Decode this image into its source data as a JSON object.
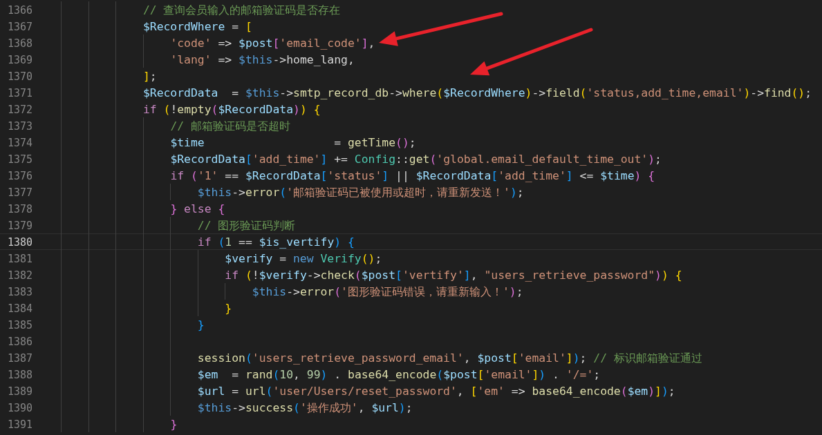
{
  "editor": {
    "lines": [
      {
        "number": "1366",
        "current": false,
        "tokens": [
          {
            "kind": "comment",
            "text": "                // 查询会员输入的邮箱验证码是否存在"
          }
        ]
      },
      {
        "number": "1367",
        "current": false,
        "tokens": [
          {
            "kind": "variable",
            "text": "                $RecordWhere"
          },
          {
            "kind": "plain",
            "text": " = "
          },
          {
            "kind": "bracket",
            "text": "[",
            "color": "#ffd700"
          }
        ]
      },
      {
        "number": "1368",
        "current": false,
        "tokens": [
          {
            "kind": "string",
            "text": "                    'code'"
          },
          {
            "kind": "plain",
            "text": " => "
          },
          {
            "kind": "variable",
            "text": "$post"
          },
          {
            "kind": "bracket",
            "text": "[",
            "color": "#da70d6"
          },
          {
            "kind": "string",
            "text": "'email_code'"
          },
          {
            "kind": "bracket",
            "text": "]",
            "color": "#da70d6"
          },
          {
            "kind": "plain",
            "text": ","
          }
        ]
      },
      {
        "number": "1369",
        "current": false,
        "tokens": [
          {
            "kind": "string",
            "text": "                    'lang'"
          },
          {
            "kind": "plain",
            "text": " => "
          },
          {
            "kind": "storage",
            "text": "$this"
          },
          {
            "kind": "plain",
            "text": "->home_lang,"
          }
        ]
      },
      {
        "number": "1370",
        "current": false,
        "tokens": [
          {
            "kind": "bracket",
            "text": "                ]",
            "color": "#ffd700"
          },
          {
            "kind": "plain",
            "text": ";"
          }
        ]
      },
      {
        "number": "1371",
        "current": false,
        "tokens": [
          {
            "kind": "variable",
            "text": "                $RecordData"
          },
          {
            "kind": "plain",
            "text": "  = "
          },
          {
            "kind": "storage",
            "text": "$this"
          },
          {
            "kind": "plain",
            "text": "->"
          },
          {
            "kind": "function",
            "text": "smtp_record_db"
          },
          {
            "kind": "plain",
            "text": "->"
          },
          {
            "kind": "function",
            "text": "where"
          },
          {
            "kind": "bracket",
            "text": "(",
            "color": "#ffd700"
          },
          {
            "kind": "variable",
            "text": "$RecordWhere"
          },
          {
            "kind": "bracket",
            "text": ")",
            "color": "#ffd700"
          },
          {
            "kind": "plain",
            "text": "->"
          },
          {
            "kind": "function",
            "text": "field"
          },
          {
            "kind": "bracket",
            "text": "(",
            "color": "#ffd700"
          },
          {
            "kind": "string",
            "text": "'status,add_time,email'"
          },
          {
            "kind": "bracket",
            "text": ")",
            "color": "#ffd700"
          },
          {
            "kind": "plain",
            "text": "->"
          },
          {
            "kind": "function",
            "text": "find"
          },
          {
            "kind": "bracket",
            "text": "()",
            "color": "#ffd700"
          },
          {
            "kind": "plain",
            "text": ";"
          }
        ]
      },
      {
        "number": "1372",
        "current": false,
        "tokens": [
          {
            "kind": "keyword",
            "text": "                if"
          },
          {
            "kind": "bracket",
            "text": " (",
            "color": "#ffd700"
          },
          {
            "kind": "plain",
            "text": "!"
          },
          {
            "kind": "function",
            "text": "empty"
          },
          {
            "kind": "bracket",
            "text": "(",
            "color": "#da70d6"
          },
          {
            "kind": "variable",
            "text": "$RecordData"
          },
          {
            "kind": "bracket",
            "text": ")",
            "color": "#da70d6"
          },
          {
            "kind": "bracket",
            "text": ")",
            "color": "#ffd700"
          },
          {
            "kind": "bracket",
            "text": " {",
            "color": "#ffd700"
          }
        ]
      },
      {
        "number": "1373",
        "current": false,
        "tokens": [
          {
            "kind": "comment",
            "text": "                    // 邮箱验证码是否超时"
          }
        ]
      },
      {
        "number": "1374",
        "current": false,
        "tokens": [
          {
            "kind": "variable",
            "text": "                    $time"
          },
          {
            "kind": "plain",
            "text": "                   = "
          },
          {
            "kind": "function",
            "text": "getTime"
          },
          {
            "kind": "bracket",
            "text": "()",
            "color": "#da70d6"
          },
          {
            "kind": "plain",
            "text": ";"
          }
        ]
      },
      {
        "number": "1375",
        "current": false,
        "tokens": [
          {
            "kind": "variable",
            "text": "                    $RecordData"
          },
          {
            "kind": "bracket",
            "text": "[",
            "color": "#179fff"
          },
          {
            "kind": "string",
            "text": "'add_time'"
          },
          {
            "kind": "bracket",
            "text": "]",
            "color": "#179fff"
          },
          {
            "kind": "plain",
            "text": " += "
          },
          {
            "kind": "type",
            "text": "Config"
          },
          {
            "kind": "plain",
            "text": "::"
          },
          {
            "kind": "function",
            "text": "get"
          },
          {
            "kind": "bracket",
            "text": "(",
            "color": "#da70d6"
          },
          {
            "kind": "string",
            "text": "'global.email_default_time_out'"
          },
          {
            "kind": "bracket",
            "text": ")",
            "color": "#da70d6"
          },
          {
            "kind": "plain",
            "text": ";"
          }
        ]
      },
      {
        "number": "1376",
        "current": false,
        "tokens": [
          {
            "kind": "keyword",
            "text": "                    if"
          },
          {
            "kind": "bracket",
            "text": " (",
            "color": "#da70d6"
          },
          {
            "kind": "string",
            "text": "'1'"
          },
          {
            "kind": "plain",
            "text": " == "
          },
          {
            "kind": "variable",
            "text": "$RecordData"
          },
          {
            "kind": "bracket",
            "text": "[",
            "color": "#179fff"
          },
          {
            "kind": "string",
            "text": "'status'"
          },
          {
            "kind": "bracket",
            "text": "]",
            "color": "#179fff"
          },
          {
            "kind": "plain",
            "text": " || "
          },
          {
            "kind": "variable",
            "text": "$RecordData"
          },
          {
            "kind": "bracket",
            "text": "[",
            "color": "#179fff"
          },
          {
            "kind": "string",
            "text": "'add_time'"
          },
          {
            "kind": "bracket",
            "text": "]",
            "color": "#179fff"
          },
          {
            "kind": "plain",
            "text": " <= "
          },
          {
            "kind": "variable",
            "text": "$time"
          },
          {
            "kind": "bracket",
            "text": ")",
            "color": "#da70d6"
          },
          {
            "kind": "bracket",
            "text": " {",
            "color": "#da70d6"
          }
        ]
      },
      {
        "number": "1377",
        "current": false,
        "tokens": [
          {
            "kind": "storage",
            "text": "                        $this"
          },
          {
            "kind": "plain",
            "text": "->"
          },
          {
            "kind": "function",
            "text": "error"
          },
          {
            "kind": "bracket",
            "text": "(",
            "color": "#179fff"
          },
          {
            "kind": "string",
            "text": "'邮箱验证码已被使用或超时，请重新发送！'"
          },
          {
            "kind": "bracket",
            "text": ")",
            "color": "#179fff"
          },
          {
            "kind": "plain",
            "text": ";"
          }
        ]
      },
      {
        "number": "1378",
        "current": false,
        "tokens": [
          {
            "kind": "bracket",
            "text": "                    }",
            "color": "#da70d6"
          },
          {
            "kind": "keyword",
            "text": " else"
          },
          {
            "kind": "bracket",
            "text": " {",
            "color": "#da70d6"
          }
        ]
      },
      {
        "number": "1379",
        "current": false,
        "tokens": [
          {
            "kind": "comment",
            "text": "                        // 图形验证码判断"
          }
        ]
      },
      {
        "number": "1380",
        "current": true,
        "tokens": [
          {
            "kind": "keyword",
            "text": "                        if"
          },
          {
            "kind": "bracket",
            "text": " (",
            "color": "#179fff"
          },
          {
            "kind": "number",
            "text": "1"
          },
          {
            "kind": "plain",
            "text": " == "
          },
          {
            "kind": "variable",
            "text": "$is_vertify"
          },
          {
            "kind": "bracket",
            "text": ")",
            "color": "#179fff"
          },
          {
            "kind": "bracket",
            "text": " {",
            "color": "#179fff"
          }
        ]
      },
      {
        "number": "1381",
        "current": false,
        "tokens": [
          {
            "kind": "variable",
            "text": "                            $verify"
          },
          {
            "kind": "plain",
            "text": " = "
          },
          {
            "kind": "storage",
            "text": "new"
          },
          {
            "kind": "type",
            "text": " Verify"
          },
          {
            "kind": "bracket",
            "text": "()",
            "color": "#ffd700"
          },
          {
            "kind": "plain",
            "text": ";"
          }
        ]
      },
      {
        "number": "1382",
        "current": false,
        "tokens": [
          {
            "kind": "keyword",
            "text": "                            if"
          },
          {
            "kind": "bracket",
            "text": " (",
            "color": "#ffd700"
          },
          {
            "kind": "plain",
            "text": "!"
          },
          {
            "kind": "variable",
            "text": "$verify"
          },
          {
            "kind": "plain",
            "text": "->"
          },
          {
            "kind": "function",
            "text": "check"
          },
          {
            "kind": "bracket",
            "text": "(",
            "color": "#da70d6"
          },
          {
            "kind": "variable",
            "text": "$post"
          },
          {
            "kind": "bracket",
            "text": "[",
            "color": "#179fff"
          },
          {
            "kind": "string",
            "text": "'vertify'"
          },
          {
            "kind": "bracket",
            "text": "]",
            "color": "#179fff"
          },
          {
            "kind": "plain",
            "text": ", "
          },
          {
            "kind": "string",
            "text": "\"users_retrieve_password\""
          },
          {
            "kind": "bracket",
            "text": ")",
            "color": "#da70d6"
          },
          {
            "kind": "bracket",
            "text": ")",
            "color": "#ffd700"
          },
          {
            "kind": "bracket",
            "text": " {",
            "color": "#ffd700"
          }
        ]
      },
      {
        "number": "1383",
        "current": false,
        "tokens": [
          {
            "kind": "storage",
            "text": "                                $this"
          },
          {
            "kind": "plain",
            "text": "->"
          },
          {
            "kind": "function",
            "text": "error"
          },
          {
            "kind": "bracket",
            "text": "(",
            "color": "#da70d6"
          },
          {
            "kind": "string",
            "text": "'图形验证码错误，请重新输入！'"
          },
          {
            "kind": "bracket",
            "text": ")",
            "color": "#da70d6"
          },
          {
            "kind": "plain",
            "text": ";"
          }
        ]
      },
      {
        "number": "1384",
        "current": false,
        "tokens": [
          {
            "kind": "bracket",
            "text": "                            }",
            "color": "#ffd700"
          }
        ]
      },
      {
        "number": "1385",
        "current": false,
        "tokens": [
          {
            "kind": "bracket",
            "text": "                        }",
            "color": "#179fff"
          }
        ]
      },
      {
        "number": "1386",
        "current": false
      },
      {
        "number": "1387",
        "current": false,
        "tokens": [
          {
            "kind": "function",
            "text": "                        session"
          },
          {
            "kind": "bracket",
            "text": "(",
            "color": "#179fff"
          },
          {
            "kind": "string",
            "text": "'users_retrieve_password_email'"
          },
          {
            "kind": "plain",
            "text": ", "
          },
          {
            "kind": "variable",
            "text": "$post"
          },
          {
            "kind": "bracket",
            "text": "[",
            "color": "#ffd700"
          },
          {
            "kind": "string",
            "text": "'email'"
          },
          {
            "kind": "bracket",
            "text": "]",
            "color": "#ffd700"
          },
          {
            "kind": "bracket",
            "text": ")",
            "color": "#179fff"
          },
          {
            "kind": "plain",
            "text": ";"
          },
          {
            "kind": "comment",
            "text": " // 标识邮箱验证通过"
          }
        ]
      },
      {
        "number": "1388",
        "current": false,
        "tokens": [
          {
            "kind": "variable",
            "text": "                        $em"
          },
          {
            "kind": "plain",
            "text": "  = "
          },
          {
            "kind": "function",
            "text": "rand"
          },
          {
            "kind": "bracket",
            "text": "(",
            "color": "#179fff"
          },
          {
            "kind": "number",
            "text": "10"
          },
          {
            "kind": "plain",
            "text": ","
          },
          {
            "kind": "number",
            "text": " 99"
          },
          {
            "kind": "bracket",
            "text": ")",
            "color": "#179fff"
          },
          {
            "kind": "plain",
            "text": " . "
          },
          {
            "kind": "function",
            "text": "base64_encode"
          },
          {
            "kind": "bracket",
            "text": "(",
            "color": "#179fff"
          },
          {
            "kind": "variable",
            "text": "$post"
          },
          {
            "kind": "bracket",
            "text": "[",
            "color": "#ffd700"
          },
          {
            "kind": "string",
            "text": "'email'"
          },
          {
            "kind": "bracket",
            "text": "]",
            "color": "#ffd700"
          },
          {
            "kind": "bracket",
            "text": ")",
            "color": "#179fff"
          },
          {
            "kind": "plain",
            "text": " . "
          },
          {
            "kind": "string",
            "text": "'/='"
          },
          {
            "kind": "plain",
            "text": ";"
          }
        ]
      },
      {
        "number": "1389",
        "current": false,
        "tokens": [
          {
            "kind": "variable",
            "text": "                        $url"
          },
          {
            "kind": "plain",
            "text": " = "
          },
          {
            "kind": "function",
            "text": "url"
          },
          {
            "kind": "bracket",
            "text": "(",
            "color": "#179fff"
          },
          {
            "kind": "string",
            "text": "'user/Users/reset_password'"
          },
          {
            "kind": "plain",
            "text": ","
          },
          {
            "kind": "bracket",
            "text": " [",
            "color": "#ffd700"
          },
          {
            "kind": "string",
            "text": "'em'"
          },
          {
            "kind": "plain",
            "text": " => "
          },
          {
            "kind": "function",
            "text": "base64_encode"
          },
          {
            "kind": "bracket",
            "text": "(",
            "color": "#da70d6"
          },
          {
            "kind": "variable",
            "text": "$em"
          },
          {
            "kind": "bracket",
            "text": ")",
            "color": "#da70d6"
          },
          {
            "kind": "bracket",
            "text": "]",
            "color": "#ffd700"
          },
          {
            "kind": "bracket",
            "text": ")",
            "color": "#179fff"
          },
          {
            "kind": "plain",
            "text": ";"
          }
        ]
      },
      {
        "number": "1390",
        "current": false,
        "tokens": [
          {
            "kind": "storage",
            "text": "                        $this"
          },
          {
            "kind": "plain",
            "text": "->"
          },
          {
            "kind": "function",
            "text": "success"
          },
          {
            "kind": "bracket",
            "text": "(",
            "color": "#179fff"
          },
          {
            "kind": "string",
            "text": "'操作成功'"
          },
          {
            "kind": "plain",
            "text": ","
          },
          {
            "kind": "variable",
            "text": " $url"
          },
          {
            "kind": "bracket",
            "text": ")",
            "color": "#179fff"
          },
          {
            "kind": "plain",
            "text": ";"
          }
        ]
      },
      {
        "number": "1391",
        "current": false,
        "tokens": [
          {
            "kind": "bracket",
            "text": "                    }",
            "color": "#da70d6"
          }
        ]
      }
    ]
  },
  "annotations": [
    {
      "kind": "arrow"
    },
    {
      "kind": "arrow"
    }
  ]
}
